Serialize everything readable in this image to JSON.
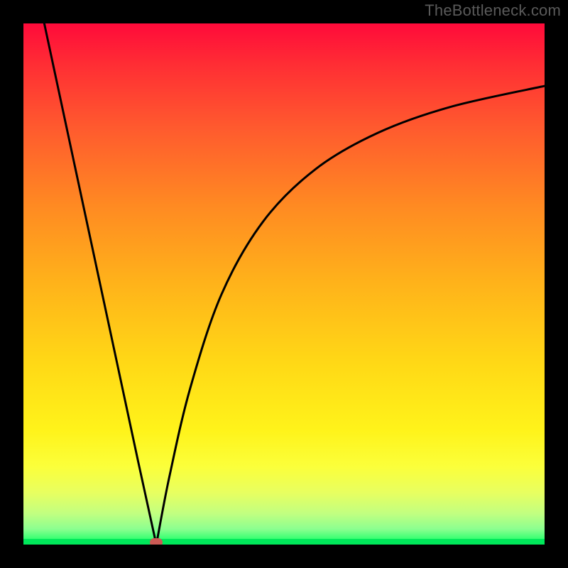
{
  "watermark": "TheBottleneck.com",
  "chart_data": {
    "type": "line",
    "title": "",
    "xlabel": "",
    "ylabel": "",
    "xlim": [
      0,
      100
    ],
    "ylim": [
      0,
      100
    ],
    "grid": false,
    "legend": false,
    "background_gradient": [
      "#ff0a3a",
      "#ff5a2e",
      "#ffb31a",
      "#fff31a",
      "#c2ff80",
      "#00e85a"
    ],
    "series": [
      {
        "name": "left-branch",
        "x": [
          4,
          10,
          16,
          22,
          25.5
        ],
        "y": [
          100,
          72,
          44,
          16,
          0
        ]
      },
      {
        "name": "right-branch",
        "x": [
          25.5,
          28,
          32,
          38,
          46,
          56,
          68,
          82,
          100
        ],
        "y": [
          0,
          13,
          30,
          48,
          62,
          72,
          79,
          84,
          88
        ]
      }
    ],
    "vertex": {
      "x": 25.5,
      "y": 0
    },
    "vertex_marker_color": "#cc5a55",
    "curve_color": "#000000",
    "curve_width": 3
  }
}
